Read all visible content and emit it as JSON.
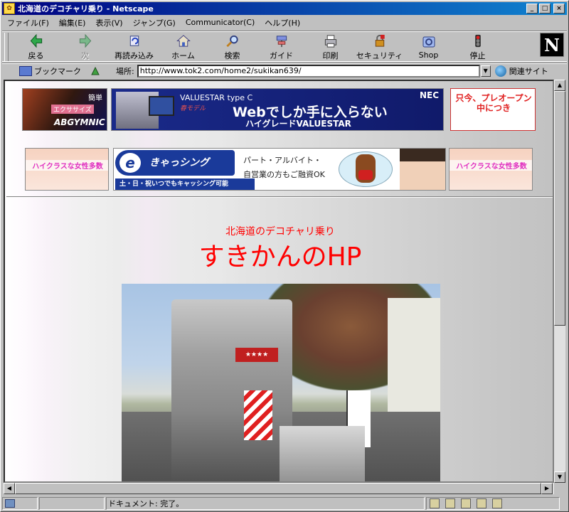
{
  "window": {
    "title": "北海道のデコチャリ乗り - Netscape"
  },
  "menu": [
    "ファイル(F)",
    "編集(E)",
    "表示(V)",
    "ジャンプ(G)",
    "Communicator(C)",
    "ヘルプ(H)"
  ],
  "toolbar": {
    "back": "戻る",
    "forward": "次",
    "reload": "再読み込み",
    "home": "ホーム",
    "search": "検索",
    "guide": "ガイド",
    "print": "印刷",
    "security": "セキュリティ",
    "shop": "Shop",
    "stop": "停止",
    "throbber": "N"
  },
  "location": {
    "bookmarks": "ブックマーク",
    "label": "場所:",
    "url": "http://www.tok2.com/home2/sukikan639/",
    "related": "関連サイト"
  },
  "banners": {
    "ab_small": "簡単",
    "ab_exercise": "エクササイズ",
    "ab_brand": "ABGYMNIC",
    "nec_product": "VALUESTAR",
    "nec_type": "type C",
    "nec_model": "春モデル",
    "nec_logo": "NEC",
    "nec_headline": "Webでしか手に入らない",
    "nec_sub": "ハイグレードVALUESTAR",
    "preopen": "只今、プレオープン中につき",
    "highclass_left": "ハイクラスな女性多数",
    "highclass_right": "ハイクラスな女性多数",
    "cash_logo": "きゃっシング",
    "cash_e": "e",
    "cash_strip": "土・日・祝いつでもキャッシング可能",
    "cash_line1": "パート・アルバイト・",
    "cash_line2": "自営業の方もご融資OK"
  },
  "page": {
    "subtitle": "北海道のデコチャリ乗り",
    "title": "すきかんのHP",
    "photo_sign": "★★★★"
  },
  "status": {
    "text": "ドキュメント: 完了。"
  },
  "colors": {
    "title_red": "#ff0000",
    "titlebar": "#000080",
    "chrome": "#c0c0c0"
  }
}
